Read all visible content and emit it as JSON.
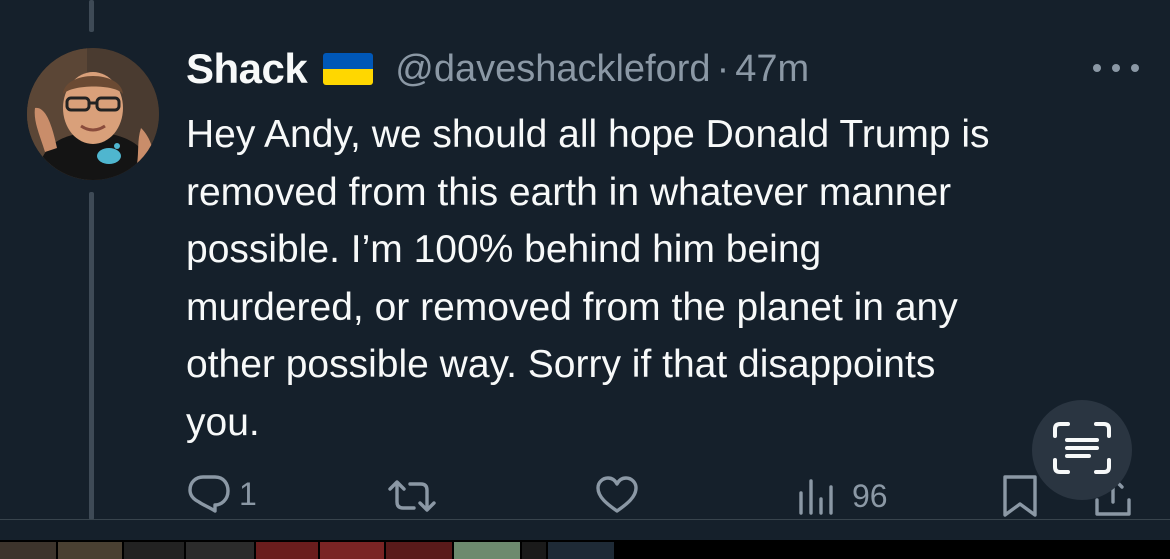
{
  "tweet": {
    "display_name": "Shack",
    "flag_icon": "ukraine-flag-icon",
    "handle": "@daveshackleford",
    "separator": "·",
    "time": "47m",
    "text": "Hey Andy, we should all hope Donald Trump is\nremoved from this earth in whatever manner\npossible. I’m 100% behind him being\nmurdered, or removed from the planet in any\nother possible way. Sorry if that disappoints\nyou."
  },
  "actions": {
    "reply_count": "1",
    "repost_count": "",
    "like_count": "",
    "view_count": "96"
  },
  "colors": {
    "background": "#15202b",
    "text_primary": "#f7f9f9",
    "text_secondary": "#8b98a5",
    "flag_blue": "#0057b7",
    "flag_yellow": "#ffd700"
  }
}
